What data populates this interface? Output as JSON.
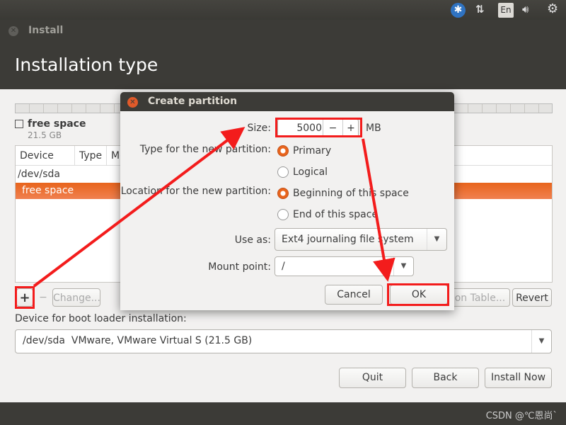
{
  "top_panel": {
    "icons": [
      "accessibility-icon",
      "network-icon",
      "keyboard-layout-icon",
      "volume-icon",
      "settings-gear-icon"
    ],
    "keyboard_layout": "En"
  },
  "window": {
    "title": "Install",
    "page_title": "Installation type"
  },
  "disk": {
    "free_space_label": "free space",
    "free_space_size": "21.5 GB"
  },
  "table": {
    "columns": [
      "Device",
      "Type",
      "Mount point"
    ],
    "rows": [
      {
        "device": "/dev/sda",
        "selected": false
      },
      {
        "device": "free space",
        "selected": true
      }
    ]
  },
  "table_buttons": {
    "add": "+",
    "remove": "−",
    "change": "Change...",
    "new_table": "New Partition Table...",
    "revert": "Revert"
  },
  "bootloader": {
    "label": "Device for boot loader installation:",
    "value": "/dev/sda  VMware, VMware Virtual S (21.5 GB)"
  },
  "nav": {
    "quit": "Quit",
    "back": "Back",
    "install_now": "Install Now"
  },
  "dialog": {
    "title": "Create partition",
    "size_label": "Size:",
    "size_value": "5000",
    "size_unit": "MB",
    "minus": "−",
    "plus": "+",
    "type_label": "Type for the new partition:",
    "type_options": [
      "Primary",
      "Logical"
    ],
    "type_selected": "Primary",
    "location_label": "Location for the new partition:",
    "location_options": [
      "Beginning of this space",
      "End of this space"
    ],
    "location_selected": "Beginning of this space",
    "use_as_label": "Use as:",
    "use_as_value": "Ext4 journaling file system",
    "mount_label": "Mount point:",
    "mount_value": "/",
    "cancel": "Cancel",
    "ok": "OK"
  },
  "watermark": "CSDN @℃恩尚`",
  "colors": {
    "accent": "#e8641c",
    "annotation": "#f31c1c",
    "panel": "#3c3b37"
  }
}
